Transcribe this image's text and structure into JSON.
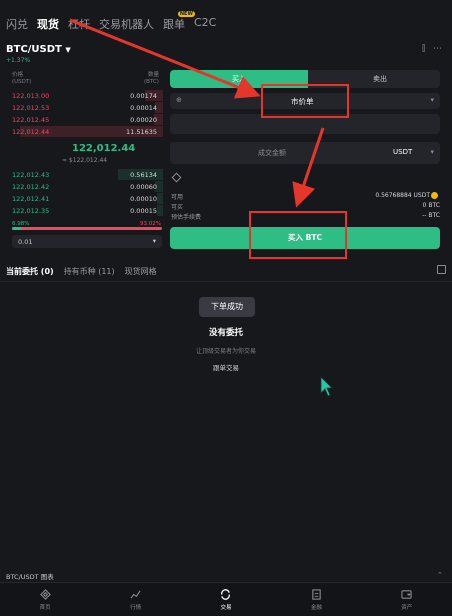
{
  "top_tabs": [
    {
      "label": "闪兑",
      "active": false
    },
    {
      "label": "现货",
      "active": true
    },
    {
      "label": "杠杆",
      "active": false
    },
    {
      "label": "交易机器人",
      "active": false
    },
    {
      "label": "跟单",
      "active": false,
      "badge": "NEW"
    },
    {
      "label": "C2C",
      "active": false
    }
  ],
  "pair": {
    "symbol": "BTC/USDT",
    "change": "+1.37%"
  },
  "order_book": {
    "price_header": "价格",
    "price_unit": "(USDT)",
    "qty_header": "数量",
    "qty_unit": "(BTC)",
    "asks": [
      {
        "price": "122,013.00",
        "qty": "0.00174",
        "depth": 0.12
      },
      {
        "price": "122,012.53",
        "qty": "0.00014",
        "depth": 0.05
      },
      {
        "price": "122,012.45",
        "qty": "0.00020",
        "depth": 0.06
      },
      {
        "price": "122,012.44",
        "qty": "11.51635",
        "depth": 0.95
      }
    ],
    "mid_price": "122,012.44",
    "mid_sub": "≈ $122,012.44",
    "bids": [
      {
        "price": "122,012.43",
        "qty": "0.56134",
        "depth": 0.3
      },
      {
        "price": "122,012.42",
        "qty": "0.00060",
        "depth": 0.05
      },
      {
        "price": "122,012.41",
        "qty": "0.00010",
        "depth": 0.04
      },
      {
        "price": "122,012.35",
        "qty": "0.00015",
        "depth": 0.04
      }
    ],
    "buy_ratio": "6.98%",
    "sell_ratio": "93.02%",
    "precision": "0.01"
  },
  "trade": {
    "buy_tab": "买入",
    "sell_tab": "卖出",
    "order_type": "市价单",
    "amount_placeholder": "成交金额",
    "amount_unit": "USDT",
    "available_label": "可用",
    "available_value": "0.56768884 USDT",
    "can_buy_label": "可买",
    "can_buy_value": "0 BTC",
    "fee_label": "预估手续费",
    "fee_value": "-- BTC",
    "submit_label": "买入 BTC"
  },
  "lower_tabs": [
    {
      "label": "当前委托 (0)",
      "active": true
    },
    {
      "label": "持有币种 (11)",
      "active": false
    },
    {
      "label": "现货网格",
      "active": false
    }
  ],
  "toast": "下单成功",
  "empty_state": {
    "title": "没有委托",
    "subtitle": "让顶级交易者为你交易",
    "link": "跟单交易"
  },
  "chart_label": "BTC/USDT 图表",
  "bottom_nav": [
    {
      "label": "首页",
      "icon": "home-icon",
      "active": false
    },
    {
      "label": "行情",
      "icon": "chart-line-icon",
      "active": false
    },
    {
      "label": "交易",
      "icon": "trade-icon",
      "active": true
    },
    {
      "label": "金融",
      "icon": "finance-icon",
      "active": false
    },
    {
      "label": "资产",
      "icon": "wallet-icon",
      "active": false
    }
  ],
  "colors": {
    "buy": "#2ebd85",
    "sell": "#f6465d",
    "annotation": "#e5362b"
  }
}
